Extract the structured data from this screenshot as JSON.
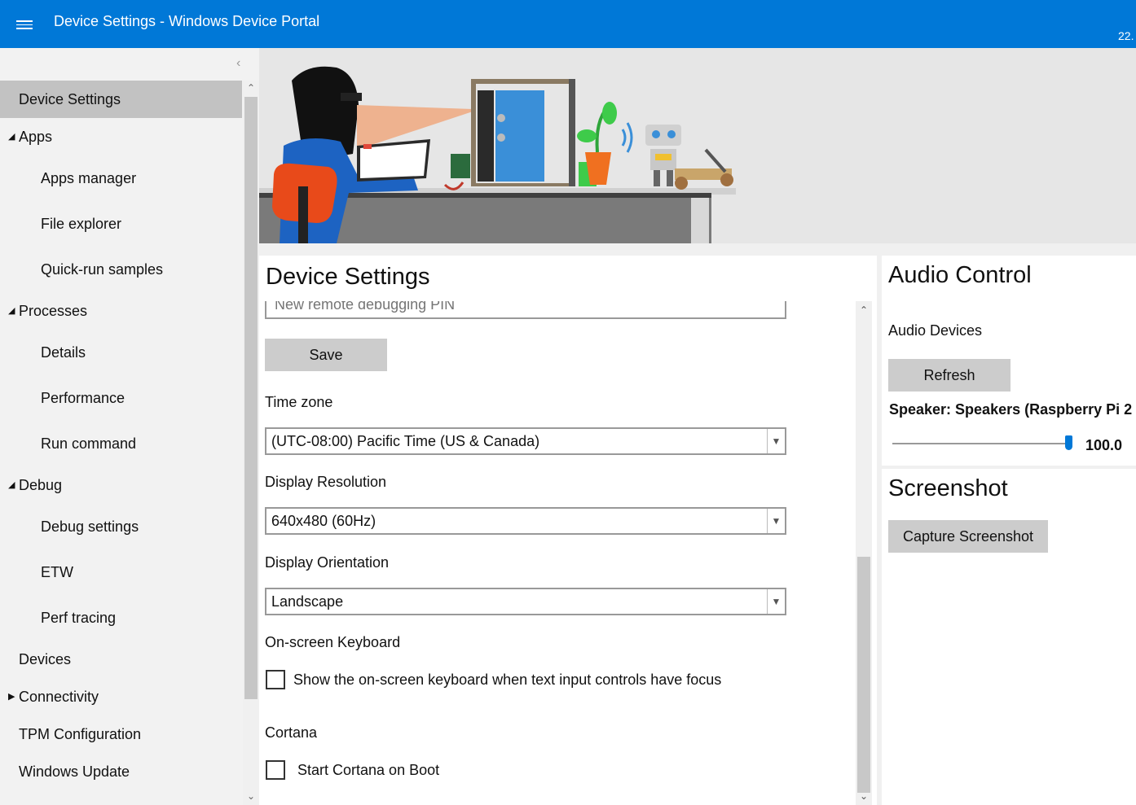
{
  "window": {
    "title": "Device Settings - Windows Device Portal",
    "version_fragment": "22."
  },
  "sidebar": {
    "items": [
      {
        "label": "Device Settings",
        "type": "top",
        "active": true
      },
      {
        "label": "Apps",
        "type": "group",
        "expanded": true
      },
      {
        "label": "Apps manager",
        "type": "sub"
      },
      {
        "label": "File explorer",
        "type": "sub"
      },
      {
        "label": "Quick-run samples",
        "type": "sub"
      },
      {
        "label": "Processes",
        "type": "group",
        "expanded": true
      },
      {
        "label": "Details",
        "type": "sub"
      },
      {
        "label": "Performance",
        "type": "sub"
      },
      {
        "label": "Run command",
        "type": "sub"
      },
      {
        "label": "Debug",
        "type": "group",
        "expanded": true
      },
      {
        "label": "Debug settings",
        "type": "sub"
      },
      {
        "label": "ETW",
        "type": "sub"
      },
      {
        "label": "Perf tracing",
        "type": "sub"
      },
      {
        "label": "Devices",
        "type": "top"
      },
      {
        "label": "Connectivity",
        "type": "group",
        "expanded": false
      },
      {
        "label": "TPM Configuration",
        "type": "top"
      },
      {
        "label": "Windows Update",
        "type": "top"
      }
    ]
  },
  "device_settings": {
    "title": "Device Settings",
    "pin_placeholder": "New remote debugging PIN",
    "save_label": "Save",
    "timezone_label": "Time zone",
    "timezone_value": "(UTC-08:00) Pacific Time (US & Canada)",
    "resolution_label": "Display Resolution",
    "resolution_value": "640x480 (60Hz)",
    "orientation_label": "Display Orientation",
    "orientation_value": "Landscape",
    "keyboard_label": "On-screen Keyboard",
    "keyboard_checkbox_label": "Show the on-screen keyboard when text input controls have focus",
    "cortana_label": "Cortana",
    "cortana_checkbox_label": "Start Cortana on Boot"
  },
  "audio": {
    "title": "Audio Control",
    "devices_label": "Audio Devices",
    "refresh_label": "Refresh",
    "speaker_label": "Speaker: Speakers (Raspberry Pi 2",
    "volume_value": "100.0",
    "volume_level": 100
  },
  "screenshot": {
    "title": "Screenshot",
    "capture_label": "Capture Screenshot"
  },
  "colors": {
    "accent": "#0078d7",
    "sidebar_active": "#c2c2c2",
    "button": "#cccccc"
  }
}
